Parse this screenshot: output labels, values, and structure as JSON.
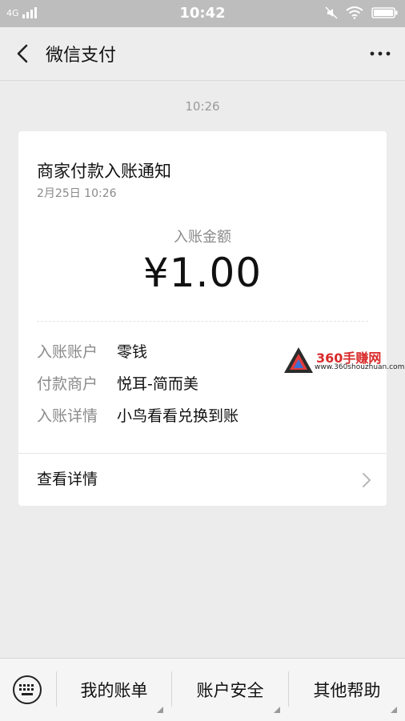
{
  "status_bar": {
    "network": "4G",
    "time": "10:42",
    "icons": [
      "signal-bars-icon",
      "mute-icon",
      "wifi-icon",
      "battery-icon"
    ]
  },
  "nav": {
    "title": "微信支付",
    "back_icon": "chevron-left-icon",
    "more_icon": "more-dots-icon"
  },
  "chat": {
    "timestamp": "10:26"
  },
  "card": {
    "title": "商家付款入账通知",
    "date": "2月25日  10:26",
    "amount_label": "入账金额",
    "amount": "¥1.00",
    "rows": [
      {
        "key": "入账账户",
        "value": "零钱"
      },
      {
        "key": "付款商户",
        "value": "悦耳-简而美"
      },
      {
        "key": "入账详情",
        "value": "小鸟看看兑换到账"
      }
    ],
    "detail_link": "查看详情"
  },
  "watermark": {
    "text": "360手赚网",
    "url": "www.360shouzhuan.com"
  },
  "bottom_menu": {
    "keyboard_icon": "keyboard-icon",
    "items": [
      "我的账单",
      "账户安全",
      "其他帮助"
    ]
  },
  "colors": {
    "background": "#ececec",
    "card": "#ffffff",
    "muted_text": "#8a8a8a",
    "status_bar": "#bdbdbd",
    "watermark_red": "#d92a2a"
  }
}
